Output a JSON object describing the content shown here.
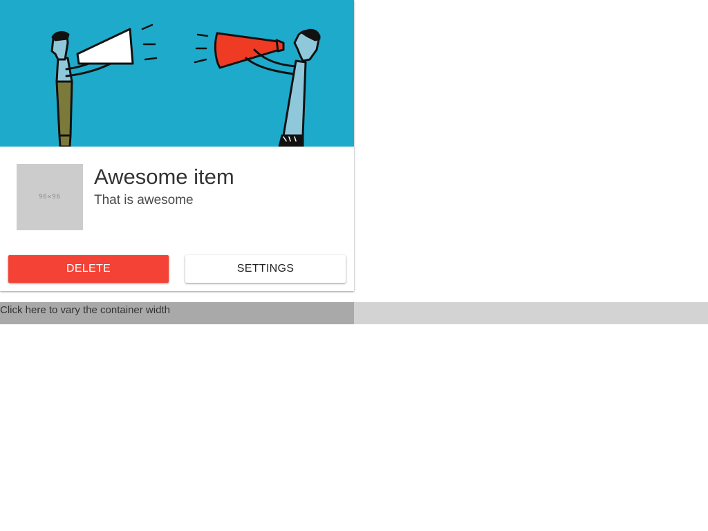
{
  "card": {
    "banner_image": "megaphone-illustration",
    "thumbnail_label": "96×96",
    "title": "Awesome item",
    "subtitle": "That is awesome",
    "actions": {
      "delete_label": "DELETE",
      "settings_label": "SETTINGS"
    }
  },
  "width_control": {
    "label": "Click here to vary the container width",
    "fraction": 0.5
  },
  "colors": {
    "banner_background": "#1eaacb",
    "delete": "#f44336",
    "placeholder": "#cccccc",
    "bar_track": "#d3d3d3",
    "bar_fill": "#a9a9a9"
  }
}
